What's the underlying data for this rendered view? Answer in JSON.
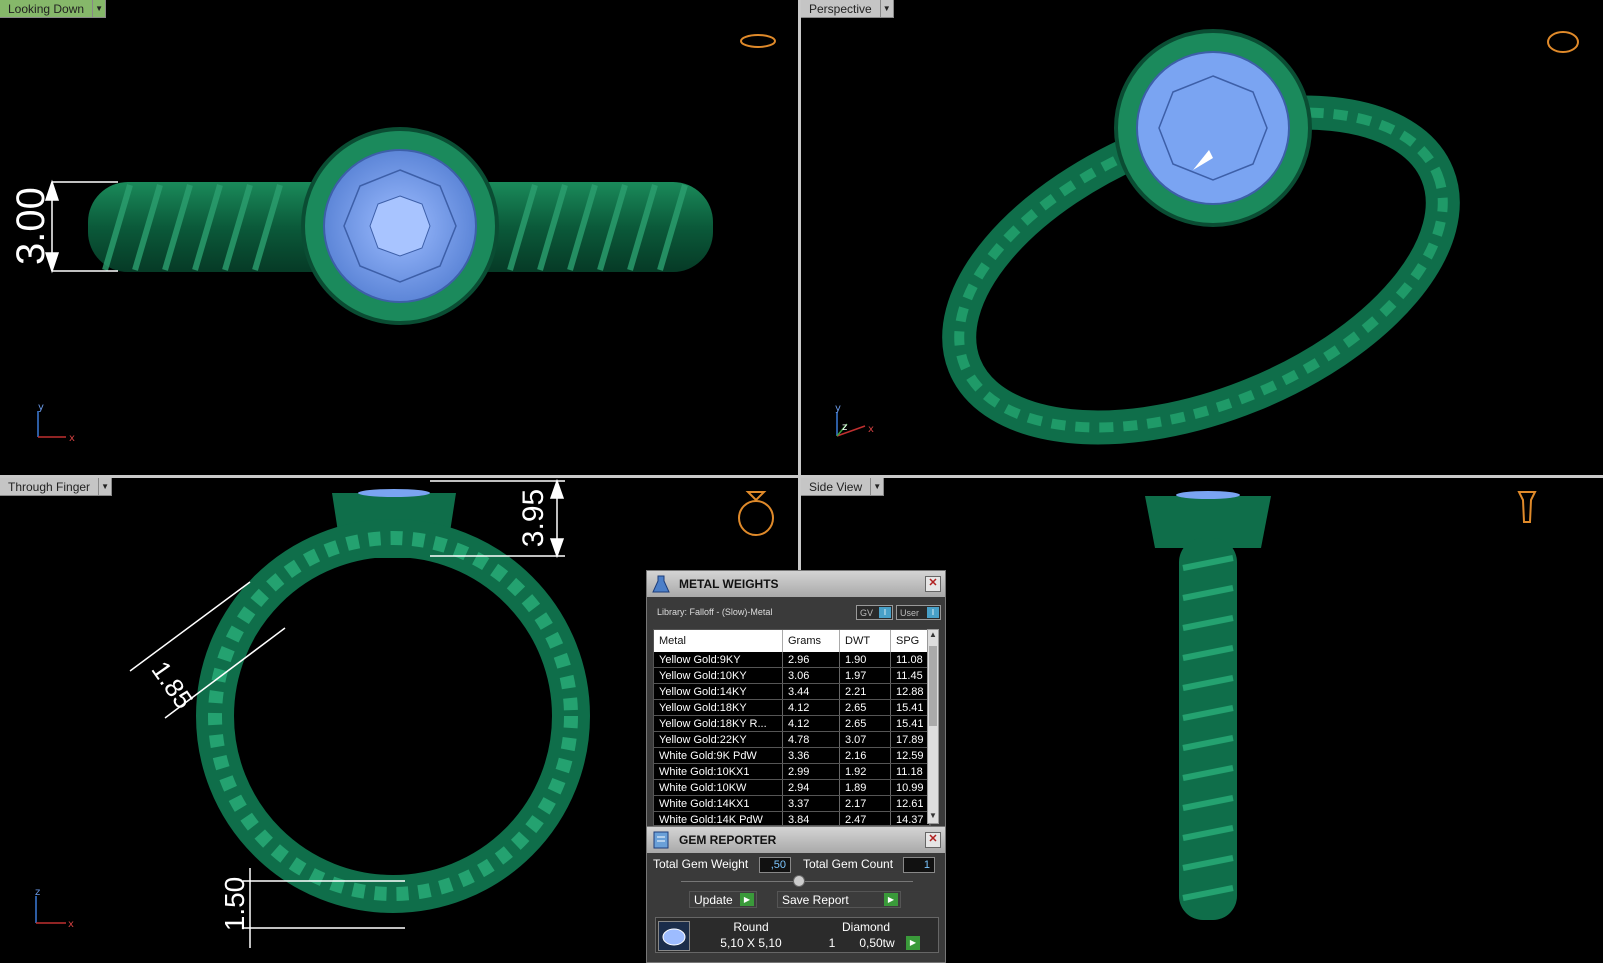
{
  "viewports": {
    "top_left": {
      "label": "Looking Down",
      "active": true,
      "dimension": "3.00",
      "axes": {
        "a": "y",
        "b": "x"
      }
    },
    "top_right": {
      "label": "Perspective",
      "active": false,
      "axes": {
        "a": "y",
        "b": "z",
        "c": "x"
      }
    },
    "bottom_left": {
      "label": "Through Finger",
      "active": false,
      "dimensions": [
        "3.95",
        "1.85",
        "1.50"
      ],
      "axes": {
        "a": "z",
        "b": "x"
      }
    },
    "bottom_right": {
      "label": "Side View",
      "active": false
    }
  },
  "metal_weights": {
    "title": "METAL WEIGHTS",
    "library": "Library: Falloff - (Slow)-Metal",
    "toggle_gv": "GV",
    "toggle_user": "User",
    "columns": [
      "Metal",
      "Grams",
      "DWT",
      "SPG"
    ],
    "rows": [
      [
        "Yellow Gold:9KY",
        "2.96",
        "1.90",
        "11.08"
      ],
      [
        "Yellow Gold:10KY",
        "3.06",
        "1.97",
        "11.45"
      ],
      [
        "Yellow Gold:14KY",
        "3.44",
        "2.21",
        "12.88"
      ],
      [
        "Yellow Gold:18KY",
        "4.12",
        "2.65",
        "15.41"
      ],
      [
        "Yellow Gold:18KY R...",
        "4.12",
        "2.65",
        "15.41"
      ],
      [
        "Yellow Gold:22KY",
        "4.78",
        "3.07",
        "17.89"
      ],
      [
        "White Gold:9K PdW",
        "3.36",
        "2.16",
        "12.59"
      ],
      [
        "White Gold:10KX1",
        "2.99",
        "1.92",
        "11.18"
      ],
      [
        "White Gold:10KW",
        "2.94",
        "1.89",
        "10.99"
      ],
      [
        "White Gold:14KX1",
        "3.37",
        "2.17",
        "12.61"
      ],
      [
        "White Gold:14K PdW",
        "3.84",
        "2.47",
        "14.37"
      ]
    ]
  },
  "gem_reporter": {
    "title": "GEM REPORTER",
    "total_weight_label": "Total Gem Weight",
    "total_weight_value": ",50",
    "total_count_label": "Total Gem Count",
    "total_count_value": "1",
    "update_label": "Update",
    "save_label": "Save Report",
    "gem": {
      "shape": "Round",
      "size": "5,10 X 5,10",
      "type": "Diamond",
      "count": "1",
      "weight": "0,50tw"
    }
  },
  "colors": {
    "metal": "#0f6e4a",
    "gem": "#7aa4f2",
    "active_label": "#86b86a"
  }
}
